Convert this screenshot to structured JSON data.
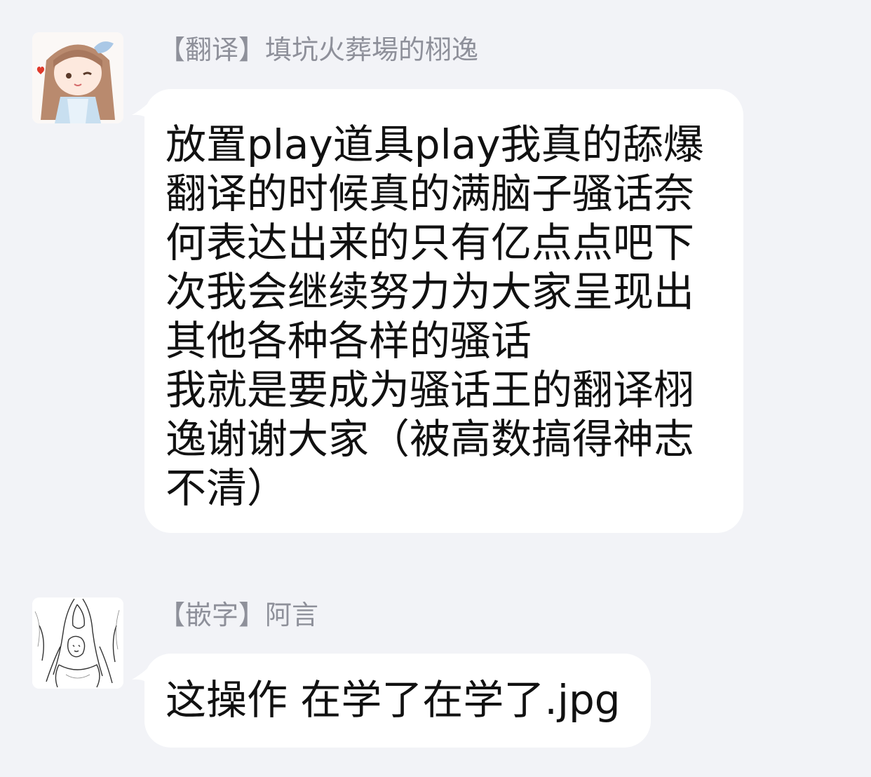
{
  "messages": [
    {
      "avatar_icon": "anime-girl-avatar-icon",
      "sender": "【翻译】填坑火葬場的栩逸",
      "lines": [
        "放置play道具play我真的舔爆",
        "翻译的时候真的满脑子骚话奈",
        "何表达出来的只有亿点点吧下",
        "次我会继续努力为大家呈现出",
        "其他各种各样的骚话",
        "我就是要成为骚话王的翻译栩",
        "逸谢谢大家（被高数搞得神志",
        "不清）"
      ]
    },
    {
      "avatar_icon": "sketch-couple-avatar-icon",
      "sender": "【嵌字】阿言",
      "lines": [
        "这操作 在学了在学了.jpg"
      ]
    }
  ],
  "colors": {
    "background": "#f2f3f7",
    "bubble": "#ffffff",
    "sender_text": "#8e909a",
    "message_text": "#111111"
  }
}
